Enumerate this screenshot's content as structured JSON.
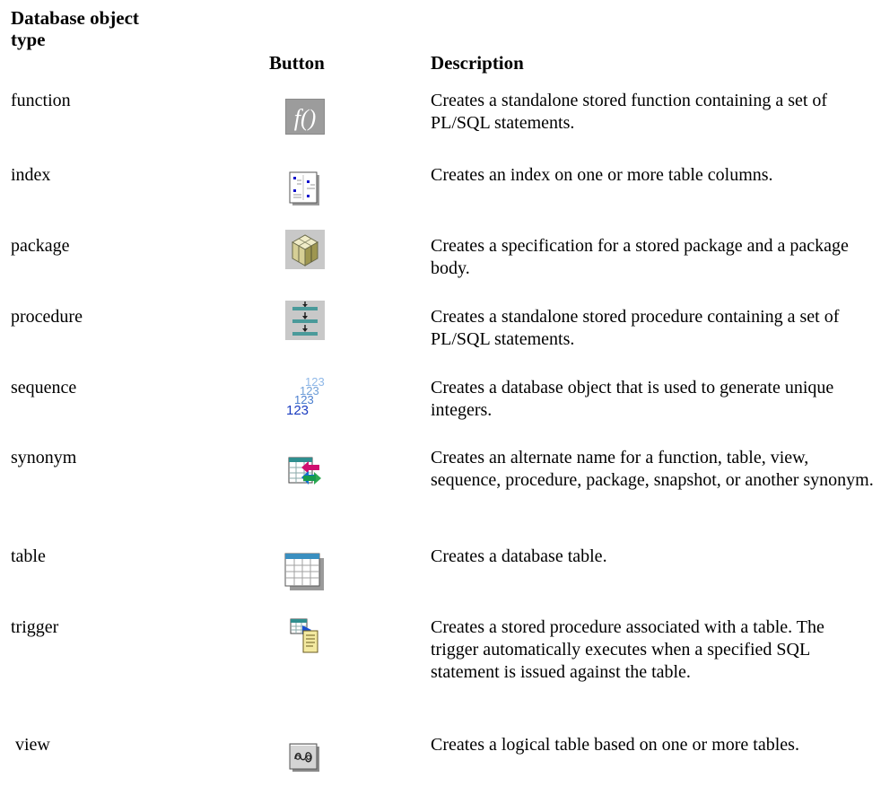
{
  "header": {
    "type_line1": "Database object",
    "type_line2": "type",
    "button": "Button",
    "description": "Description"
  },
  "rows": [
    {
      "type": "function",
      "icon": "function-icon",
      "description": "Creates a standalone stored function containing a set of PL/SQL statements."
    },
    {
      "type": "index",
      "icon": "index-icon",
      "description": "Creates an index on one or more table columns."
    },
    {
      "type": "package",
      "icon": "package-icon",
      "description": "Creates a specification for a stored package and a package body."
    },
    {
      "type": "procedure",
      "icon": "procedure-icon",
      "description": "Creates a standalone stored procedure containing a set of PL/SQL statements."
    },
    {
      "type": "sequence",
      "icon": "sequence-icon",
      "description": "Creates a database object that is used to generate unique integers."
    },
    {
      "type": "synonym",
      "icon": "synonym-icon",
      "description": "Creates an alternate name for a function, table, view, sequence, procedure, package, snapshot, or another synonym."
    },
    {
      "type": "table",
      "icon": "table-icon",
      "description": "Creates a database table."
    },
    {
      "type": "trigger",
      "icon": "trigger-icon",
      "description": "Creates a stored procedure associated with a table. The trigger automatically executes when a specified SQL statement is issued against the table."
    },
    {
      "type": " view",
      "icon": "view-icon",
      "description": "Creates a logical table based on one or more tables."
    }
  ],
  "icon_glyphs": {
    "function": "f()",
    "sequence_back": "123",
    "sequence_front": "123"
  }
}
